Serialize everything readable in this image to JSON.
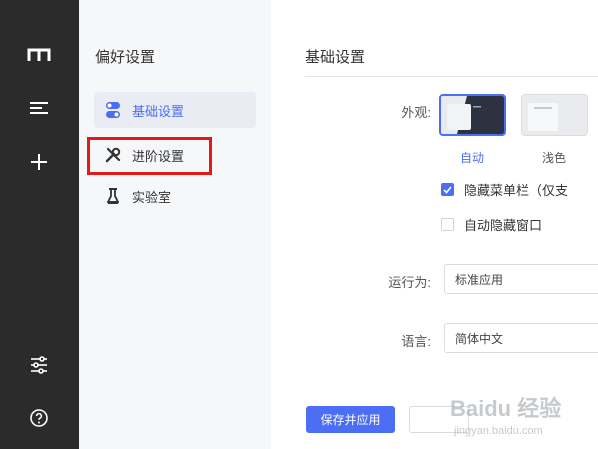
{
  "sidebar": {
    "title": "偏好设置",
    "items": [
      {
        "label": "基础设置",
        "icon": "toggle-icon",
        "active": true
      },
      {
        "label": "进阶设置",
        "icon": "wrench-icon",
        "active": false
      },
      {
        "label": "实验室",
        "icon": "flask-icon",
        "active": false
      }
    ]
  },
  "rail": {
    "icons": [
      "logo-m-icon",
      "menu-lines-icon",
      "plus-icon",
      "sliders-icon",
      "help-icon"
    ]
  },
  "main": {
    "title": "基础设置",
    "appearance": {
      "label": "外观:",
      "options": [
        {
          "label": "自动",
          "selected": true
        },
        {
          "label": "浅色",
          "selected": false
        }
      ]
    },
    "checkboxes": [
      {
        "label": "隐藏菜单栏（仅支",
        "checked": true
      },
      {
        "label": "自动隐藏窗口",
        "checked": false
      }
    ],
    "run_as": {
      "label": "运行为:",
      "value": "标准应用"
    },
    "language": {
      "label": "语言:",
      "value": "简体中文"
    },
    "save_button": "保存并应用"
  },
  "watermark": {
    "brand": "Baidu 经验",
    "url": "jingyan.baidu.com"
  },
  "colors": {
    "accent": "#4c6ef5",
    "rail_bg": "#2b2b2b",
    "sidebar_bg": "#f6f7f9",
    "highlight": "#e61919"
  }
}
